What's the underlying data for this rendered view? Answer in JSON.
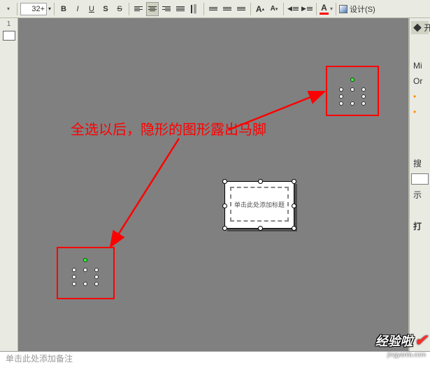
{
  "toolbar": {
    "font_size": "32+",
    "bold": "B",
    "italic": "I",
    "underline": "U",
    "strike": "S",
    "shadow": "S",
    "superscript": "A",
    "subscript": "A",
    "font_letter": "A",
    "design_label": "设计(S)"
  },
  "right_pane": {
    "start_label": "开始",
    "line1": "Mi",
    "line2": "Or",
    "search_label": "搜",
    "example_label": "示",
    "open_label": "打"
  },
  "annotations": {
    "main_text": "全选以后，隐形的图形露出马脚"
  },
  "center_object": {
    "line1": "单击此处添加标题"
  },
  "notes": {
    "placeholder": "单击此处添加备注"
  },
  "watermark": {
    "text": "经验啦",
    "sub": "jingyanla.com"
  }
}
